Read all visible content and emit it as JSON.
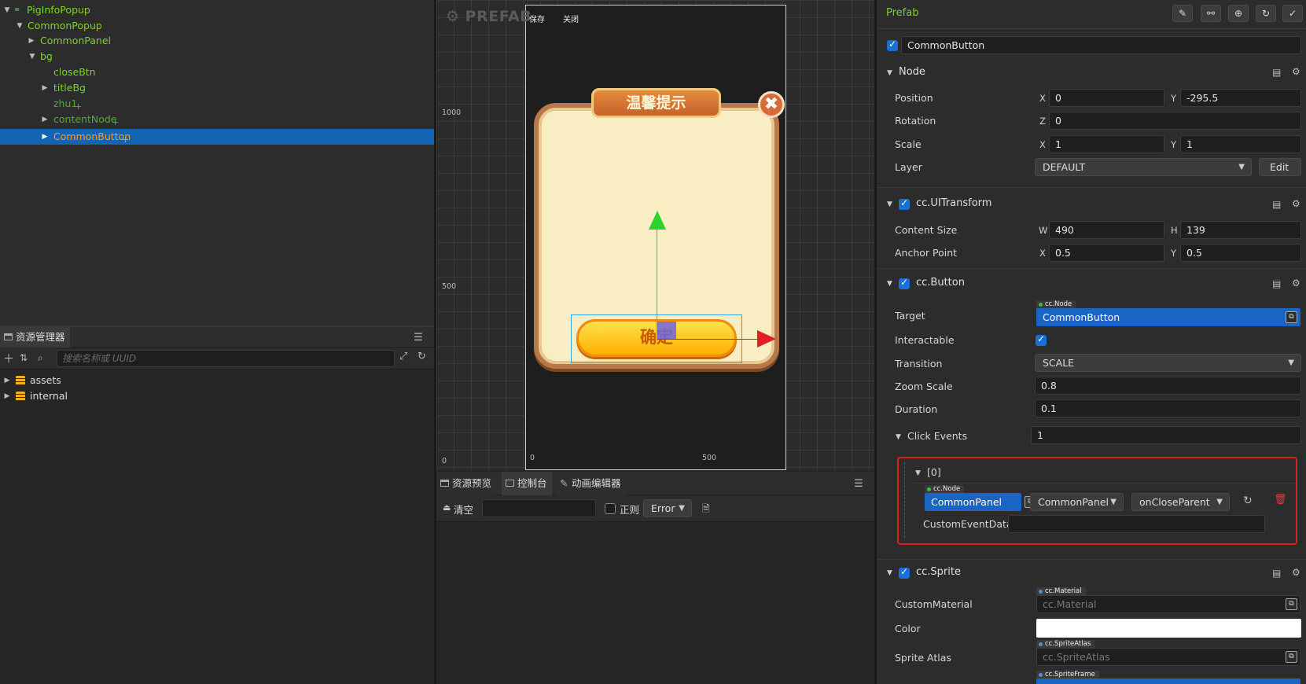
{
  "hierarchy": {
    "nodes": [
      {
        "label": "PigInfoPopup",
        "expanded": true
      },
      {
        "label": "CommonPopup",
        "expanded": true
      },
      {
        "label": "CommonPanel",
        "expanded": false
      },
      {
        "label": "bg",
        "expanded": true
      },
      {
        "label": "closeBtn"
      },
      {
        "label": "titleBg",
        "expanded": false
      },
      {
        "label": "zhu1"
      },
      {
        "label": "contentNode",
        "expanded": false
      },
      {
        "label": "CommonButton",
        "expanded": false,
        "selected": true
      }
    ]
  },
  "assets": {
    "tab_label": "资源管理器",
    "search_placeholder": "搜索名称或 UUID",
    "items": [
      {
        "label": "assets"
      },
      {
        "label": "internal"
      }
    ]
  },
  "scene": {
    "prefab_label": "PREFAB",
    "save_label": "保存",
    "close_label": "关闭",
    "ruler": {
      "y_1000": "1000",
      "y_500": "500",
      "y_0": "0",
      "x_0": "0",
      "x_500": "500"
    },
    "popup_title": "温馨提示",
    "close_glyph": "✖",
    "ok_label": "确定"
  },
  "console": {
    "tabs": [
      {
        "label": "资源预览"
      },
      {
        "label": "控制台"
      },
      {
        "label": "动画编辑器"
      }
    ],
    "clear_label": "清空",
    "regex_label": "正则",
    "level_value": "Error"
  },
  "inspector": {
    "prefab_title": "Prefab",
    "node_name": "CommonButton",
    "node": {
      "title": "Node",
      "position_label": "Position",
      "position_x": "0",
      "position_y": "-295.5",
      "rotation_label": "Rotation",
      "rotation_z": "0",
      "scale_label": "Scale",
      "scale_x": "1",
      "scale_y": "1",
      "layer_label": "Layer",
      "layer_value": "DEFAULT",
      "edit_label": "Edit"
    },
    "uitransform": {
      "title": "cc.UITransform",
      "content_size_label": "Content Size",
      "width": "490",
      "height": "139",
      "anchor_label": "Anchor Point",
      "anchor_x": "0.5",
      "anchor_y": "0.5"
    },
    "button": {
      "title": "cc.Button",
      "target_label": "Target",
      "target_type": "cc.Node",
      "target_value": "CommonButton",
      "interactable_label": "Interactable",
      "interactable": true,
      "transition_label": "Transition",
      "transition_value": "SCALE",
      "zoom_label": "Zoom Scale",
      "zoom_value": "0.8",
      "duration_label": "Duration",
      "duration_value": "0.1",
      "click_events_label": "Click Events",
      "click_events_count": "1",
      "event": {
        "index_label": "[0]",
        "node_type": "cc.Node",
        "node_value": "CommonPanel",
        "component_value": "CommonPanel",
        "handler_value": "onCloseParent",
        "custom_data_label": "CustomEventData",
        "custom_data_value": ""
      }
    },
    "sprite": {
      "title": "cc.Sprite",
      "material_label": "CustomMaterial",
      "material_type": "cc.Material",
      "material_placeholder": "cc.Material",
      "color_label": "Color",
      "color_value": "#ffffff",
      "atlas_label": "Sprite Atlas",
      "atlas_type": "cc.SpriteAtlas",
      "atlas_placeholder": "cc.SpriteAtlas",
      "frame_type": "cc.SpriteFrame"
    }
  },
  "colors": {
    "selection": "#1464b4",
    "node_green": "#7cd32c",
    "prefab_orange": "#f0a020",
    "highlight_red": "#e0201e"
  }
}
